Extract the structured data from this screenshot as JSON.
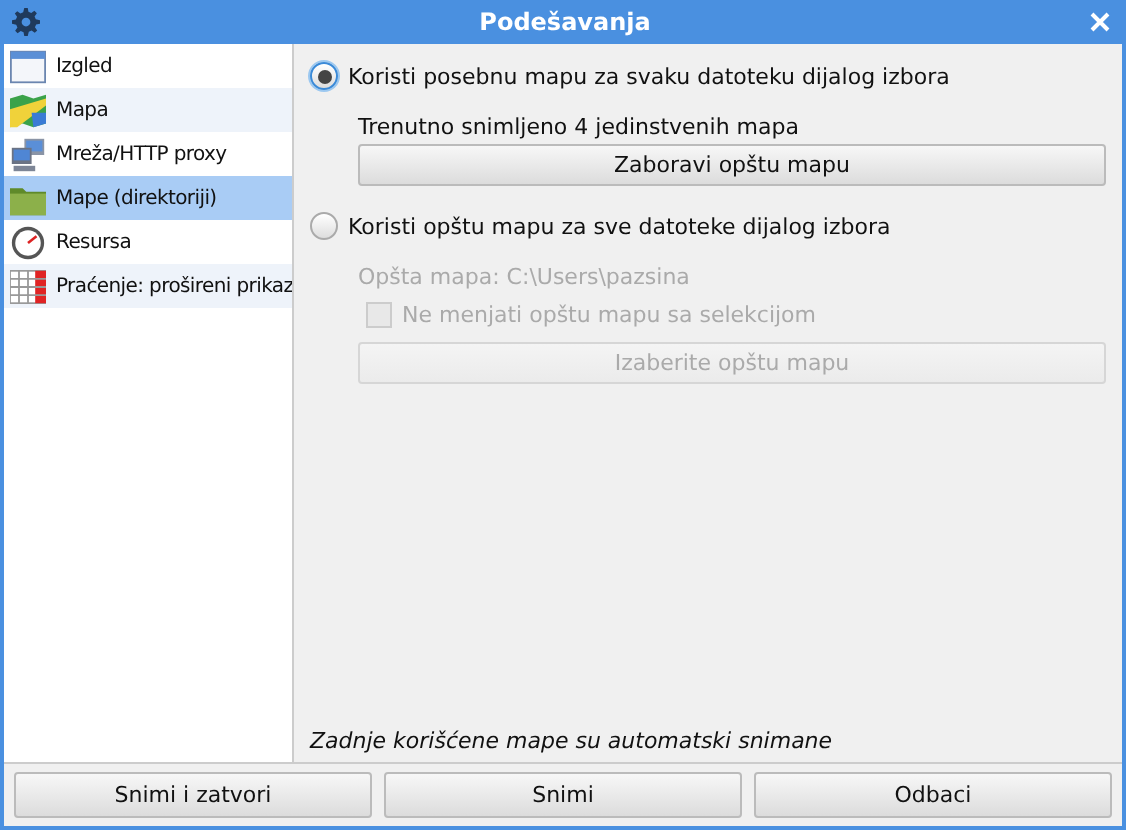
{
  "window": {
    "title": "Podešavanja"
  },
  "sidebar": {
    "items": [
      {
        "label": "Izgled",
        "kind": "window",
        "selected": false
      },
      {
        "label": "Mapa",
        "kind": "map",
        "selected": false
      },
      {
        "label": "Mreža/HTTP proxy",
        "kind": "network",
        "selected": false
      },
      {
        "label": "Mape (direktoriji)",
        "kind": "folder",
        "selected": true
      },
      {
        "label": "Resursa",
        "kind": "gauge",
        "selected": false
      },
      {
        "label": "Praćenje: prošireni prikaz",
        "kind": "table",
        "selected": false
      }
    ]
  },
  "panel": {
    "options": [
      {
        "label": "Koristi posebnu mapu za svaku datoteku dijalog izbora",
        "selected": true,
        "info": "Trenutno snimljeno 4 jedinstvenih mapa",
        "button": "Zaboravi opštu mapu"
      },
      {
        "label": "Koristi opštu mapu za sve datoteke dijalog izbora",
        "selected": false,
        "info": "Opšta mapa: C:\\Users\\pazsina",
        "checkbox": {
          "label": "Ne menjati opštu mapu sa selekcijom",
          "checked": false
        },
        "button": "Izaberite opštu mapu"
      }
    ],
    "footnote": "Zadnje korišćene mape su automatski snimane"
  },
  "buttons": [
    "Snimi i zatvori",
    "Snimi",
    "Odbaci"
  ]
}
